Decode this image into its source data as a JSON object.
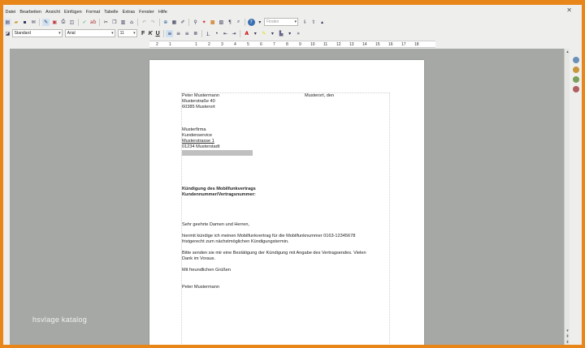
{
  "menubar": [
    "Datei",
    "Bearbeiten",
    "Ansicht",
    "Einfügen",
    "Format",
    "Tabelle",
    "Extras",
    "Fenster",
    "Hilfe"
  ],
  "toolbar1": {
    "find_placeholder": "Finden"
  },
  "toolbar2": {
    "paragraph_style": "Standard",
    "font_name": "Arial",
    "font_size": "11",
    "bold": "F",
    "italic": "K",
    "underline": "U"
  },
  "ruler_ticks": [
    "2",
    "1",
    "1",
    "2",
    "3",
    "4",
    "5",
    "6",
    "7",
    "8",
    "9",
    "10",
    "11",
    "12",
    "13",
    "14",
    "15",
    "16",
    "17",
    "18"
  ],
  "letter": {
    "sender_name": "Peter Mustermann",
    "sender_place_date": "Musterort, den",
    "sender_street": "Musterstraße 40",
    "sender_city": "60385 Musterort",
    "recipient_company": "Musterfirma",
    "recipient_dept": "Kundenservice",
    "recipient_street": "Musterstrasse 1",
    "recipient_city": "01234 Musterstadt",
    "subject_line1": "Kündigung des Mobilfunkvertrags",
    "subject_line2": "Kundennummer/Vertragsnummer:",
    "salutation": "Sehr geehrte Damen und Herren,",
    "body1_line1": "hiermit kündige ich meinen Mobilfunkvertrag für die Mobilfunknummer 0163-12345678",
    "body1_line2": "fristgerecht zum nächstmöglichen Kündigungstermin.",
    "body2_line1": "Bitte senden sie mir eine Bestätigung der Kündigung mit Angabe des Vertragsendes. Vielen",
    "body2_line2": "Dank im Voraus.",
    "closing": "Mit freundlichen Grüßen",
    "signature": "Peter Mustermann"
  },
  "watermark": "hsvlage katalog"
}
